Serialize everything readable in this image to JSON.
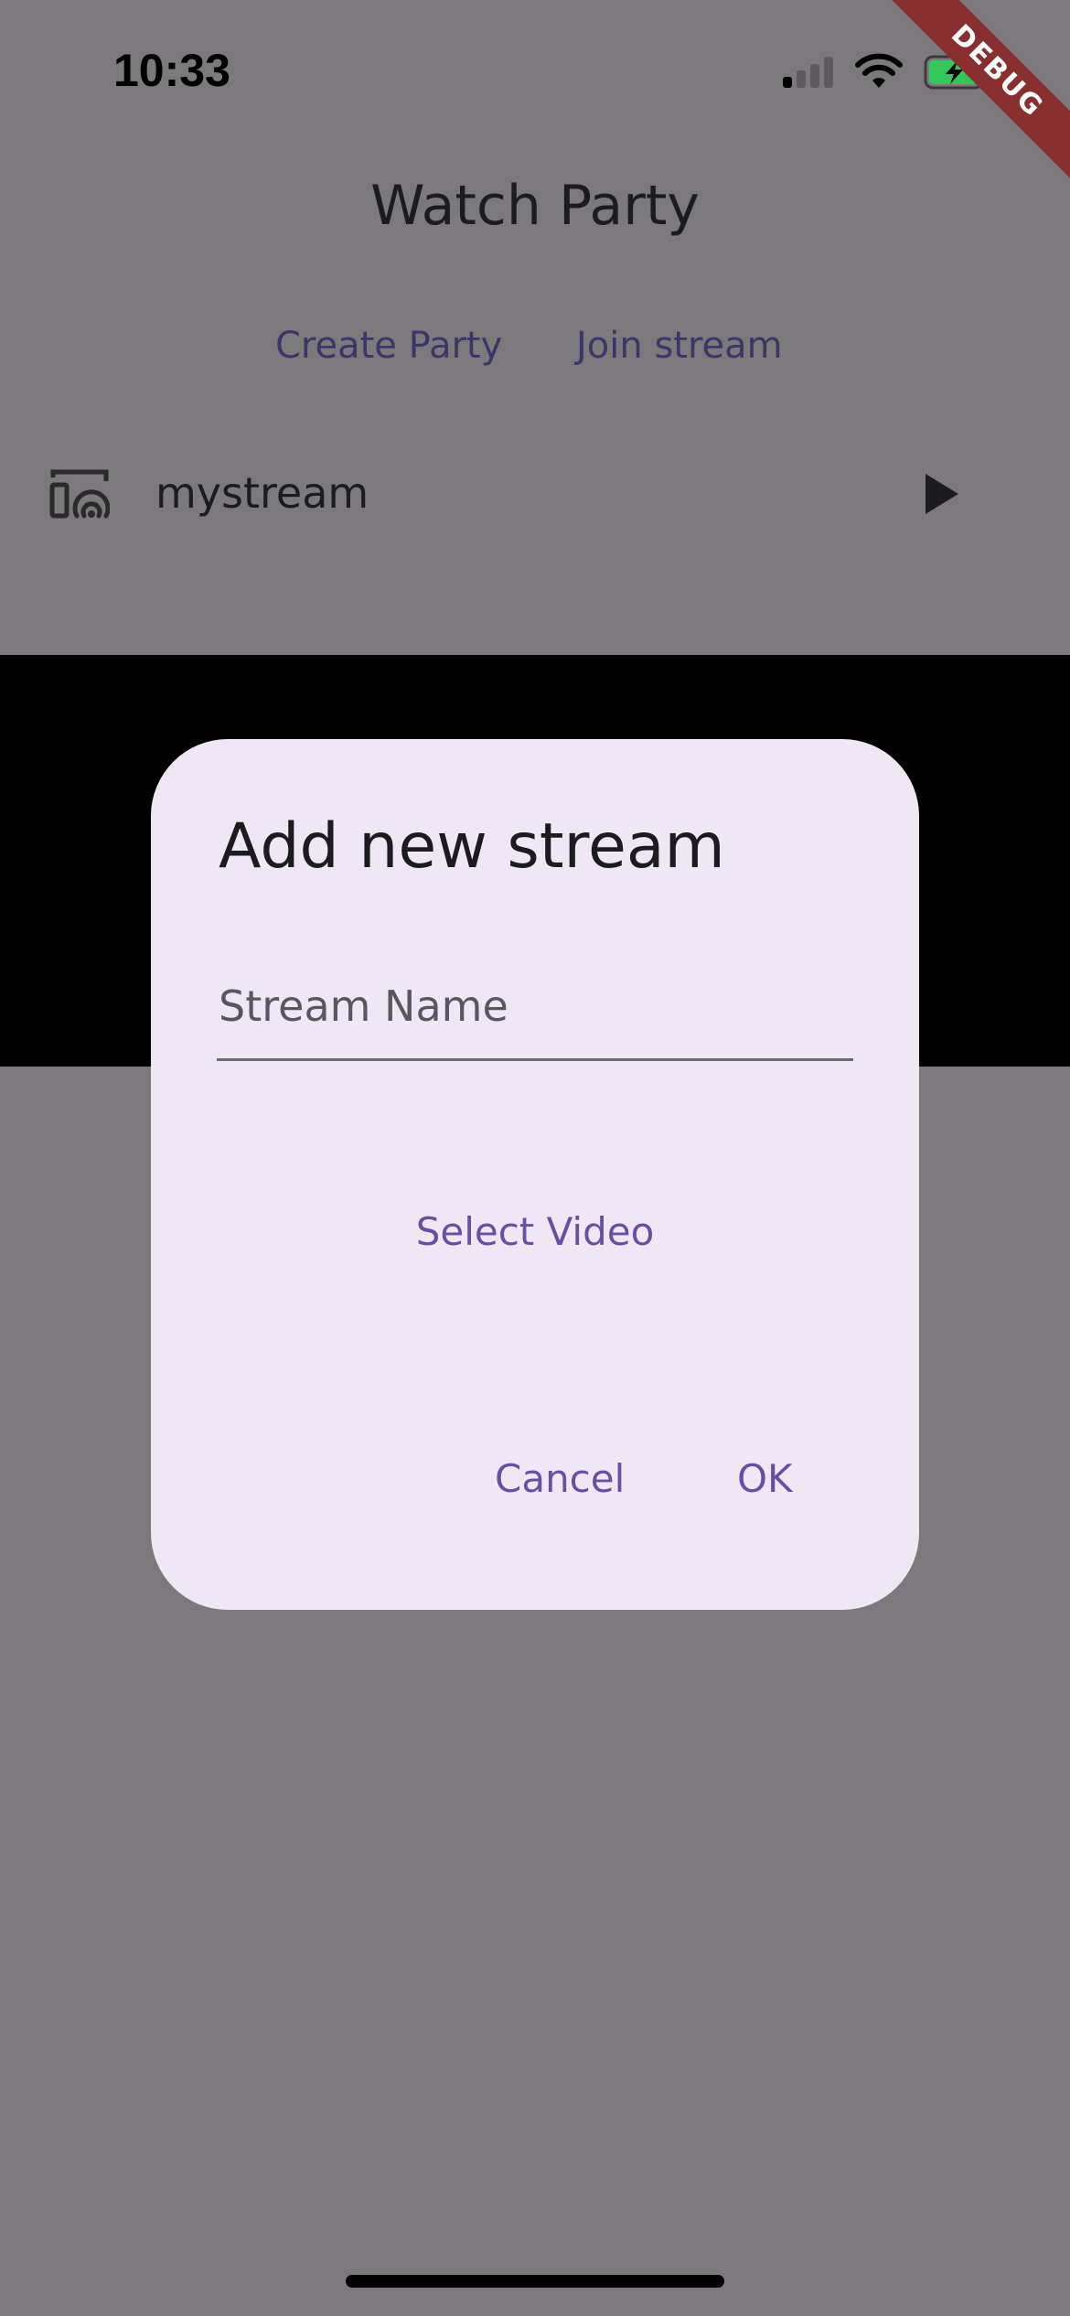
{
  "status_bar": {
    "time": "10:33"
  },
  "debug_banner": "DEBUG",
  "app": {
    "title": "Watch Party",
    "actions": [
      {
        "label": "Create Party"
      },
      {
        "label": "Join stream"
      }
    ]
  },
  "stream_list": [
    {
      "name": "mystream",
      "icon": "cast-stream-icon",
      "action_icon": "play-icon"
    }
  ],
  "dialog": {
    "title": "Add new stream",
    "stream_name_input": {
      "value": "",
      "placeholder": "Stream Name"
    },
    "select_video_label": "Select Video",
    "cancel_label": "Cancel",
    "ok_label": "OK"
  },
  "colors": {
    "scrim_background": "#7b797b",
    "dialog_surface": "#efe8f4",
    "primary": "#6750a4",
    "battery_fill": "#34c759",
    "debug_ribbon": "#8a2f2f"
  }
}
